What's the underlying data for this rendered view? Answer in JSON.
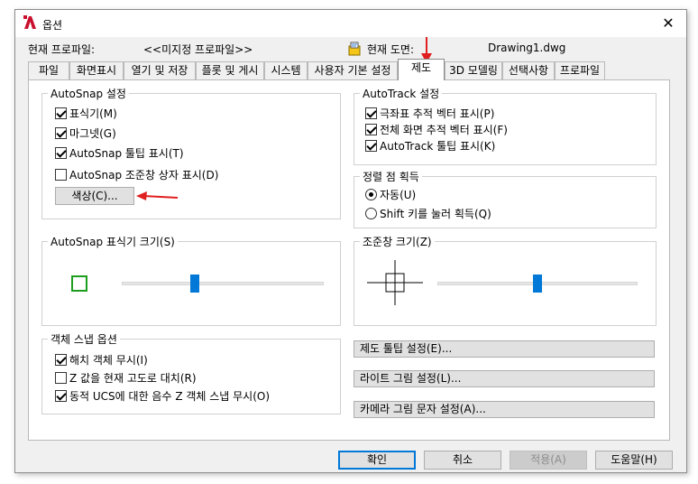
{
  "window": {
    "title": "옵션",
    "close_glyph": "✕",
    "icon": "autocad-icon"
  },
  "profile": {
    "label": "현재 프로파일:",
    "value": "<<미지정 프로파일>>",
    "drawing_label": "현재 도면:",
    "drawing_value": "Drawing1.dwg"
  },
  "tabs": [
    "파일",
    "화면표시",
    "열기 및 저장",
    "플롯 및 게시",
    "시스템",
    "사용자 기본 설정",
    "제도",
    "3D 모델링",
    "선택사항",
    "프로파일"
  ],
  "active_tab": "제도",
  "autosnap": {
    "title": "AutoSnap 설정",
    "options": [
      {
        "label": "표식기(M)",
        "checked": true
      },
      {
        "label": "마그넷(G)",
        "checked": true
      },
      {
        "label": "AutoSnap 툴팁 표시(T)",
        "checked": true
      },
      {
        "label": "AutoSnap 조준창 상자 표시(D)",
        "checked": false
      }
    ],
    "color_button": "색상(C)..."
  },
  "autotrack": {
    "title": "AutoTrack 설정",
    "options": [
      {
        "label": "극좌표 추적 벡터 표시(P)",
        "checked": true
      },
      {
        "label": "전체 화면 추적 벡터 표시(F)",
        "checked": true
      },
      {
        "label": "AutoTrack 툴팁 표시(K)",
        "checked": true
      }
    ]
  },
  "alignment": {
    "title": "정렬 점 획득",
    "options": [
      {
        "label": "자동(U)",
        "selected": true
      },
      {
        "label": "Shift 키를 눌러 획득(Q)",
        "selected": false
      }
    ]
  },
  "marker_size": {
    "title": "AutoSnap 표식기 크기(S)",
    "level": 0.36,
    "marker_color": "#1e9e1e"
  },
  "aperture_size": {
    "title": "조준창 크기(Z)",
    "level": 0.5
  },
  "osnap": {
    "title": "객체 스냅 옵션",
    "options": [
      {
        "label": "해치 객체 무시(I)",
        "checked": true
      },
      {
        "label": "Z 값을 현재 고도로 대치(R)",
        "checked": false
      },
      {
        "label": "동적 UCS에 대한 음수 Z 객체 스냅 무시(O)",
        "checked": true
      }
    ]
  },
  "side_buttons": [
    "제도 툴팁 설정(E)...",
    "라이트 그림 설정(L)...",
    "카메라 그림 문자 설정(A)..."
  ],
  "footer": {
    "ok": "확인",
    "cancel": "취소",
    "apply": "적용(A)",
    "help": "도움말(H)"
  },
  "colors": {
    "accent": "#0078d7",
    "annotation_arrow": "#e02020"
  }
}
